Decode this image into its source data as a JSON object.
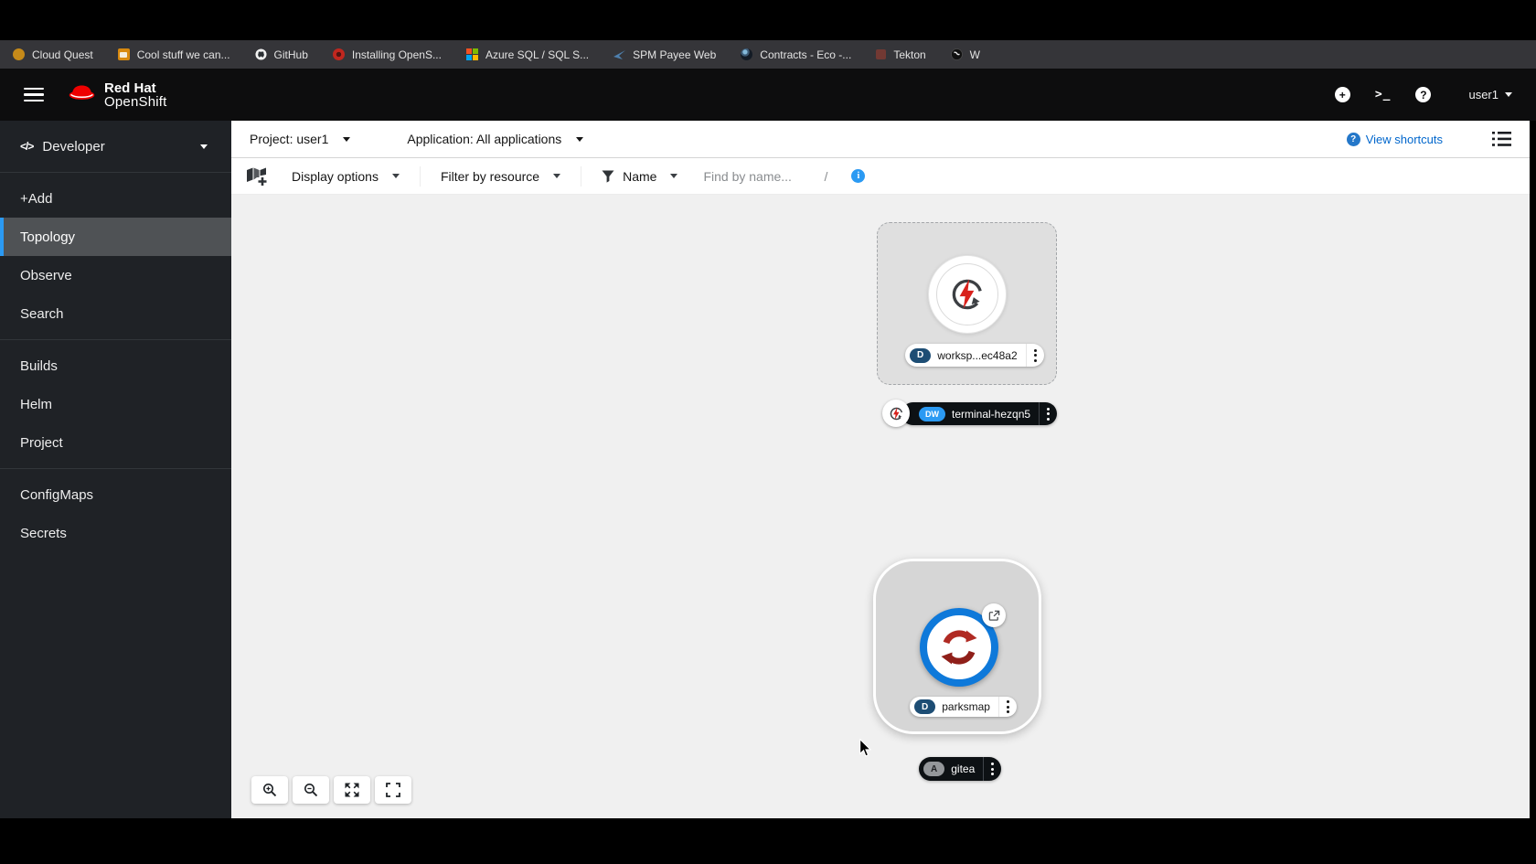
{
  "bookmarks": {
    "items": [
      {
        "label": "Cloud Quest"
      },
      {
        "label": "Cool stuff we can..."
      },
      {
        "label": "GitHub"
      },
      {
        "label": "Installing OpenS..."
      },
      {
        "label": "Azure SQL / SQL S..."
      },
      {
        "label": "SPM Payee Web"
      },
      {
        "label": "Contracts - Eco -..."
      },
      {
        "label": "Tekton"
      },
      {
        "label": "W"
      }
    ]
  },
  "masthead": {
    "brand_line1": "Red Hat",
    "brand_line2": "OpenShift",
    "username": "user1"
  },
  "icon_glyphs": {
    "developer_perspective": "</>",
    "masthead_plus": "+",
    "masthead_terminal": ">_",
    "masthead_help": "?",
    "view_shortcuts_help": "?",
    "info": "i"
  },
  "sidebar": {
    "perspective": "Developer",
    "active_item": "Topology",
    "sections": [
      {
        "items": [
          "+Add",
          "Topology",
          "Observe",
          "Search"
        ]
      },
      {
        "items": [
          "Builds",
          "Helm",
          "Project"
        ]
      },
      {
        "items": [
          "ConfigMaps",
          "Secrets"
        ]
      }
    ]
  },
  "context_bar": {
    "project": "Project: user1",
    "application": "Application: All applications",
    "view_shortcuts": "View shortcuts"
  },
  "toolbar": {
    "display_options": "Display options",
    "filter_by_resource": "Filter by resource",
    "name_filter": "Name",
    "find_placeholder": "Find by name...",
    "shortcut_hint": "/"
  },
  "topology": {
    "workspace": {
      "badge": "D",
      "label": "worksp...ec48a2"
    },
    "terminal": {
      "badge": "DW",
      "label": "terminal-hezqn5"
    },
    "parksmap": {
      "badge": "D",
      "label": "parksmap"
    },
    "gitea": {
      "badge": "A",
      "label": "gitea"
    }
  },
  "colors": {
    "link_blue": "#0066cc",
    "info_blue": "#2b9af3",
    "active_nav_indicator": "#2b9af3",
    "badge_deployment": "#1d4d74",
    "badge_devworkspace": "#2b9af3",
    "badge_application": "#94979a",
    "node_ring_blue": "#0e79da",
    "node_icon_red": "#b02a23",
    "canvas_bg": "#f0f0f0",
    "masthead_bg": "#0d0d0e",
    "sidebar_bg": "#1f2226"
  }
}
